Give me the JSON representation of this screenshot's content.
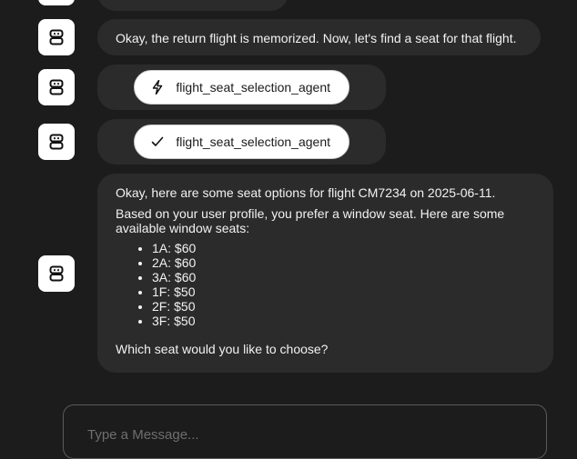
{
  "messages": {
    "m0": {
      "label": ""
    },
    "m1": {
      "text": "Okay, the return flight is memorized. Now, let's find a seat for that flight."
    },
    "m2": {
      "tool_label": "flight_seat_selection_agent",
      "icon": "bolt-icon"
    },
    "m3": {
      "tool_label": "flight_seat_selection_agent",
      "icon": "check-icon"
    },
    "m4": {
      "line1": "Okay, here are some seat options for flight CM7234 on 2025-06-11.",
      "line2": "Based on your user profile, you prefer a window seat. Here are some available window seats:",
      "seats": [
        "1A: $60",
        "2A: $60",
        "3A: $60",
        "1F: $50",
        "2F: $50",
        "3F: $50"
      ],
      "closing": "Which seat would you like to choose?"
    }
  },
  "avatar_icon": "robot-icon",
  "input": {
    "placeholder": "Type a Message..."
  },
  "colors": {
    "background": "#1c1c1c",
    "bubble": "#2b2b2b",
    "pill": "#ffffff",
    "avatar": "#ffffff"
  }
}
